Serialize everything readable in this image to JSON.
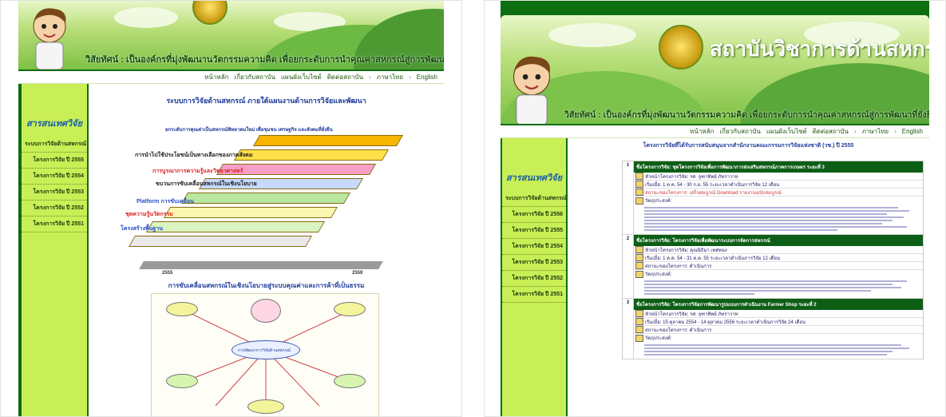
{
  "left": {
    "vision": "วิสัยทัศน์ : เป็นองค์กรที่มุ่งพัฒนานวัตกรรมความคิด เพื่อยกระดับการนำคุณค่าสหกรณ์สู่การพัฒนาที่ยั่งยืน",
    "nav": [
      "หน้าหลัก",
      "เกี่ยวกับสถาบัน",
      "แผนผังเว็บไซต์",
      "ติดต่อสถาบัน",
      "ภาษาไทย",
      "English"
    ],
    "sidebar_title": "สารสนเทศวิจัย",
    "sidebar_items": [
      "ระบบการวิจัยด้านสหกรณ์",
      "โครงการวิจัย ปี 2555",
      "โครงการวิจัย ปี 2554",
      "โครงการวิจัย ปี 2553",
      "โครงการวิจัย ปี 2552",
      "โครงการวิจัย ปี 2551"
    ],
    "page_title": "ระบบการวิจัยด้านสหกรณ์ ภายใต้แผนงานด้านการวิจัยและพัฒนา",
    "stair_labels": [
      "การนำไปใช้ประโยชน์เป็นทางเลือกของภาคสังคม",
      "การบูรณาการความรู้และวิทยาศาสตร์",
      "ขบวนการขับเคลื่อนสหกรณ์ในเชิงนโยบาย",
      "Platform การขับเคลื่อน",
      "ชุดความรู้นวัตกรรม",
      "โครงสร้างพื้นฐาน"
    ],
    "top_text": "ยกระดับการคุณค่าเป็นสหกรณ์พิทยาคมใหม่ เพื่อชุมชน เศรษฐกิจ และสังคมที่ยั่งยืน",
    "bottom_text": "การขับเคลื่อนสหกรณ์ในเชิงนโยบายสู่ระบบคุณค่าและการค้าที่เป็นธรรม",
    "timeline": [
      "2555",
      "2559"
    ],
    "mindmap_center": "การพัฒนาการวิจัยด้านสหกรณ์"
  },
  "right": {
    "brand": "สถาบันวิชาการด้านสหกรณ์",
    "vision": "วิสัยทัศน์ : เป็นองค์กรที่มุ่งพัฒนานวัตกรรมความคิด เพื่อยกระดับการนำคุณค่าสหกรณ์สู่การพัฒนาที่ยั่งยืน",
    "nav": [
      "หน้าหลัก",
      "เกี่ยวกับสถาบัน",
      "แผนผังเว็บไซต์",
      "ติดต่อสถาบัน",
      "ภาษาไทย",
      "English"
    ],
    "sidebar_title": "สารสนเทศวิจัย",
    "sidebar_items": [
      "ระบบการวิจัยด้านสหกรณ์",
      "โครงการวิจัย ปี 2556",
      "โครงการวิจัย ปี 2555",
      "โครงการวิจัย ปี 2554",
      "โครงการวิจัย ปี 2553",
      "โครงการวิจัย ปี 2552",
      "โครงการวิจัย ปี 2551"
    ],
    "page_title": "โครงการวิจัยที่ได้รับการสนับสนุนจากสำนักงานคณะกรรมการวิจัยแห่งชาติ (วช.) ปี 2555",
    "projects": [
      {
        "num": "1",
        "title": "ชื่อโครงการวิจัย: ชุดโครงการวิจัยเพื่อการพัฒนาการส่งเสริมสหกรณ์ภาคการเกษตร ระยะที่ 3",
        "lead": "หัวหน้าโครงการวิจัย: รศ. จุฑาทิพย์ ภัทราวาท",
        "period": "เริ่มเมื่อ: 1 ต.ค. 54 - 30 ก.ย. 55 ระยะเวลาดำเนินการวิจัย 12 เดือน",
        "status": "สถานะของโครงการ: เสร็จสมบูรณ์ Download รายงานฉบับสมบูรณ์",
        "objective": "วัตถุประสงค์:"
      },
      {
        "num": "2",
        "title": "ชื่อโครงการวิจัย: โครงการวิจัยเพื่อพัฒนาระบบการจัดการสหกรณ์",
        "lead": "หัวหน้าโครงการวิจัย: คุณนิธิมา เทศทอง",
        "period": "เริ่มเมื่อ: 1 ต.ค. 54 - 31 ต.ค. 55 ระยะเวลาดำเนินการวิจัย 12 เดือน",
        "status": "สถานะของโครงการ: ดำเนินการ",
        "objective": "วัตถุประสงค์:"
      },
      {
        "num": "3",
        "title": "ชื่อโครงการวิจัย: โครงการวิจัยการพัฒนารูปแบบการดำเนินงาน Farmer Shop ระยะที่ 2",
        "lead": "หัวหน้าโครงการวิจัย: รศ. จุฑาทิพย์ ภัทราวาท",
        "period": "เริ่มเมื่อ: 15 ตุลาคม 2554 - 14 ตุลาคม 2556 ระยะเวลาดำเนินการวิจัย 24 เดือน",
        "status": "สถานะของโครงการ: ดำเนินการ",
        "objective": "วัตถุประสงค์:"
      }
    ]
  },
  "colors": {
    "frame": "#0d6e12",
    "sidebar": "#c9ef57",
    "title_blue": "#1f3c9a"
  }
}
